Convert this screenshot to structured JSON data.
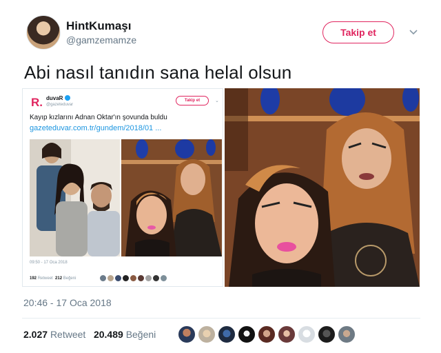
{
  "tweet": {
    "display_name": "HintKumaşı",
    "handle": "@gamzemamze",
    "follow_label": "Takip et",
    "text": "Abi nasıl tanıdın sana helal olsun",
    "timestamp": "20:46 - 17 Oca 2018",
    "retweets_count": "2.027",
    "retweets_label": "Retweet",
    "likes_count": "20.489",
    "likes_label": "Beğeni"
  },
  "embedded": {
    "logo": "R.",
    "display_name": "duvaR",
    "handle": "@gazeteduvar",
    "follow_label": "Takip et",
    "text": "Kayıp kızlarını Adnan Oktar'ın şovunda buldu",
    "link": "gazeteduvar.com.tr/gundem/2018/01 ...",
    "timestamp": "09:50 - 17 Oca 2018",
    "retweets_count": "192",
    "retweets_label": "Retweet",
    "likes_count": "212",
    "likes_label": "Beğeni"
  },
  "colors": {
    "accent": "#e0245e",
    "link": "#1b95e0",
    "muted": "#657786",
    "verified": "#1da1f2"
  },
  "icons": {
    "more": "chevron-down-icon",
    "verified": "verified-badge-icon"
  },
  "likers": [
    "liker-1",
    "liker-2",
    "liker-3",
    "liker-4",
    "liker-5",
    "liker-6",
    "liker-7",
    "liker-8",
    "liker-9",
    "liker-10"
  ]
}
